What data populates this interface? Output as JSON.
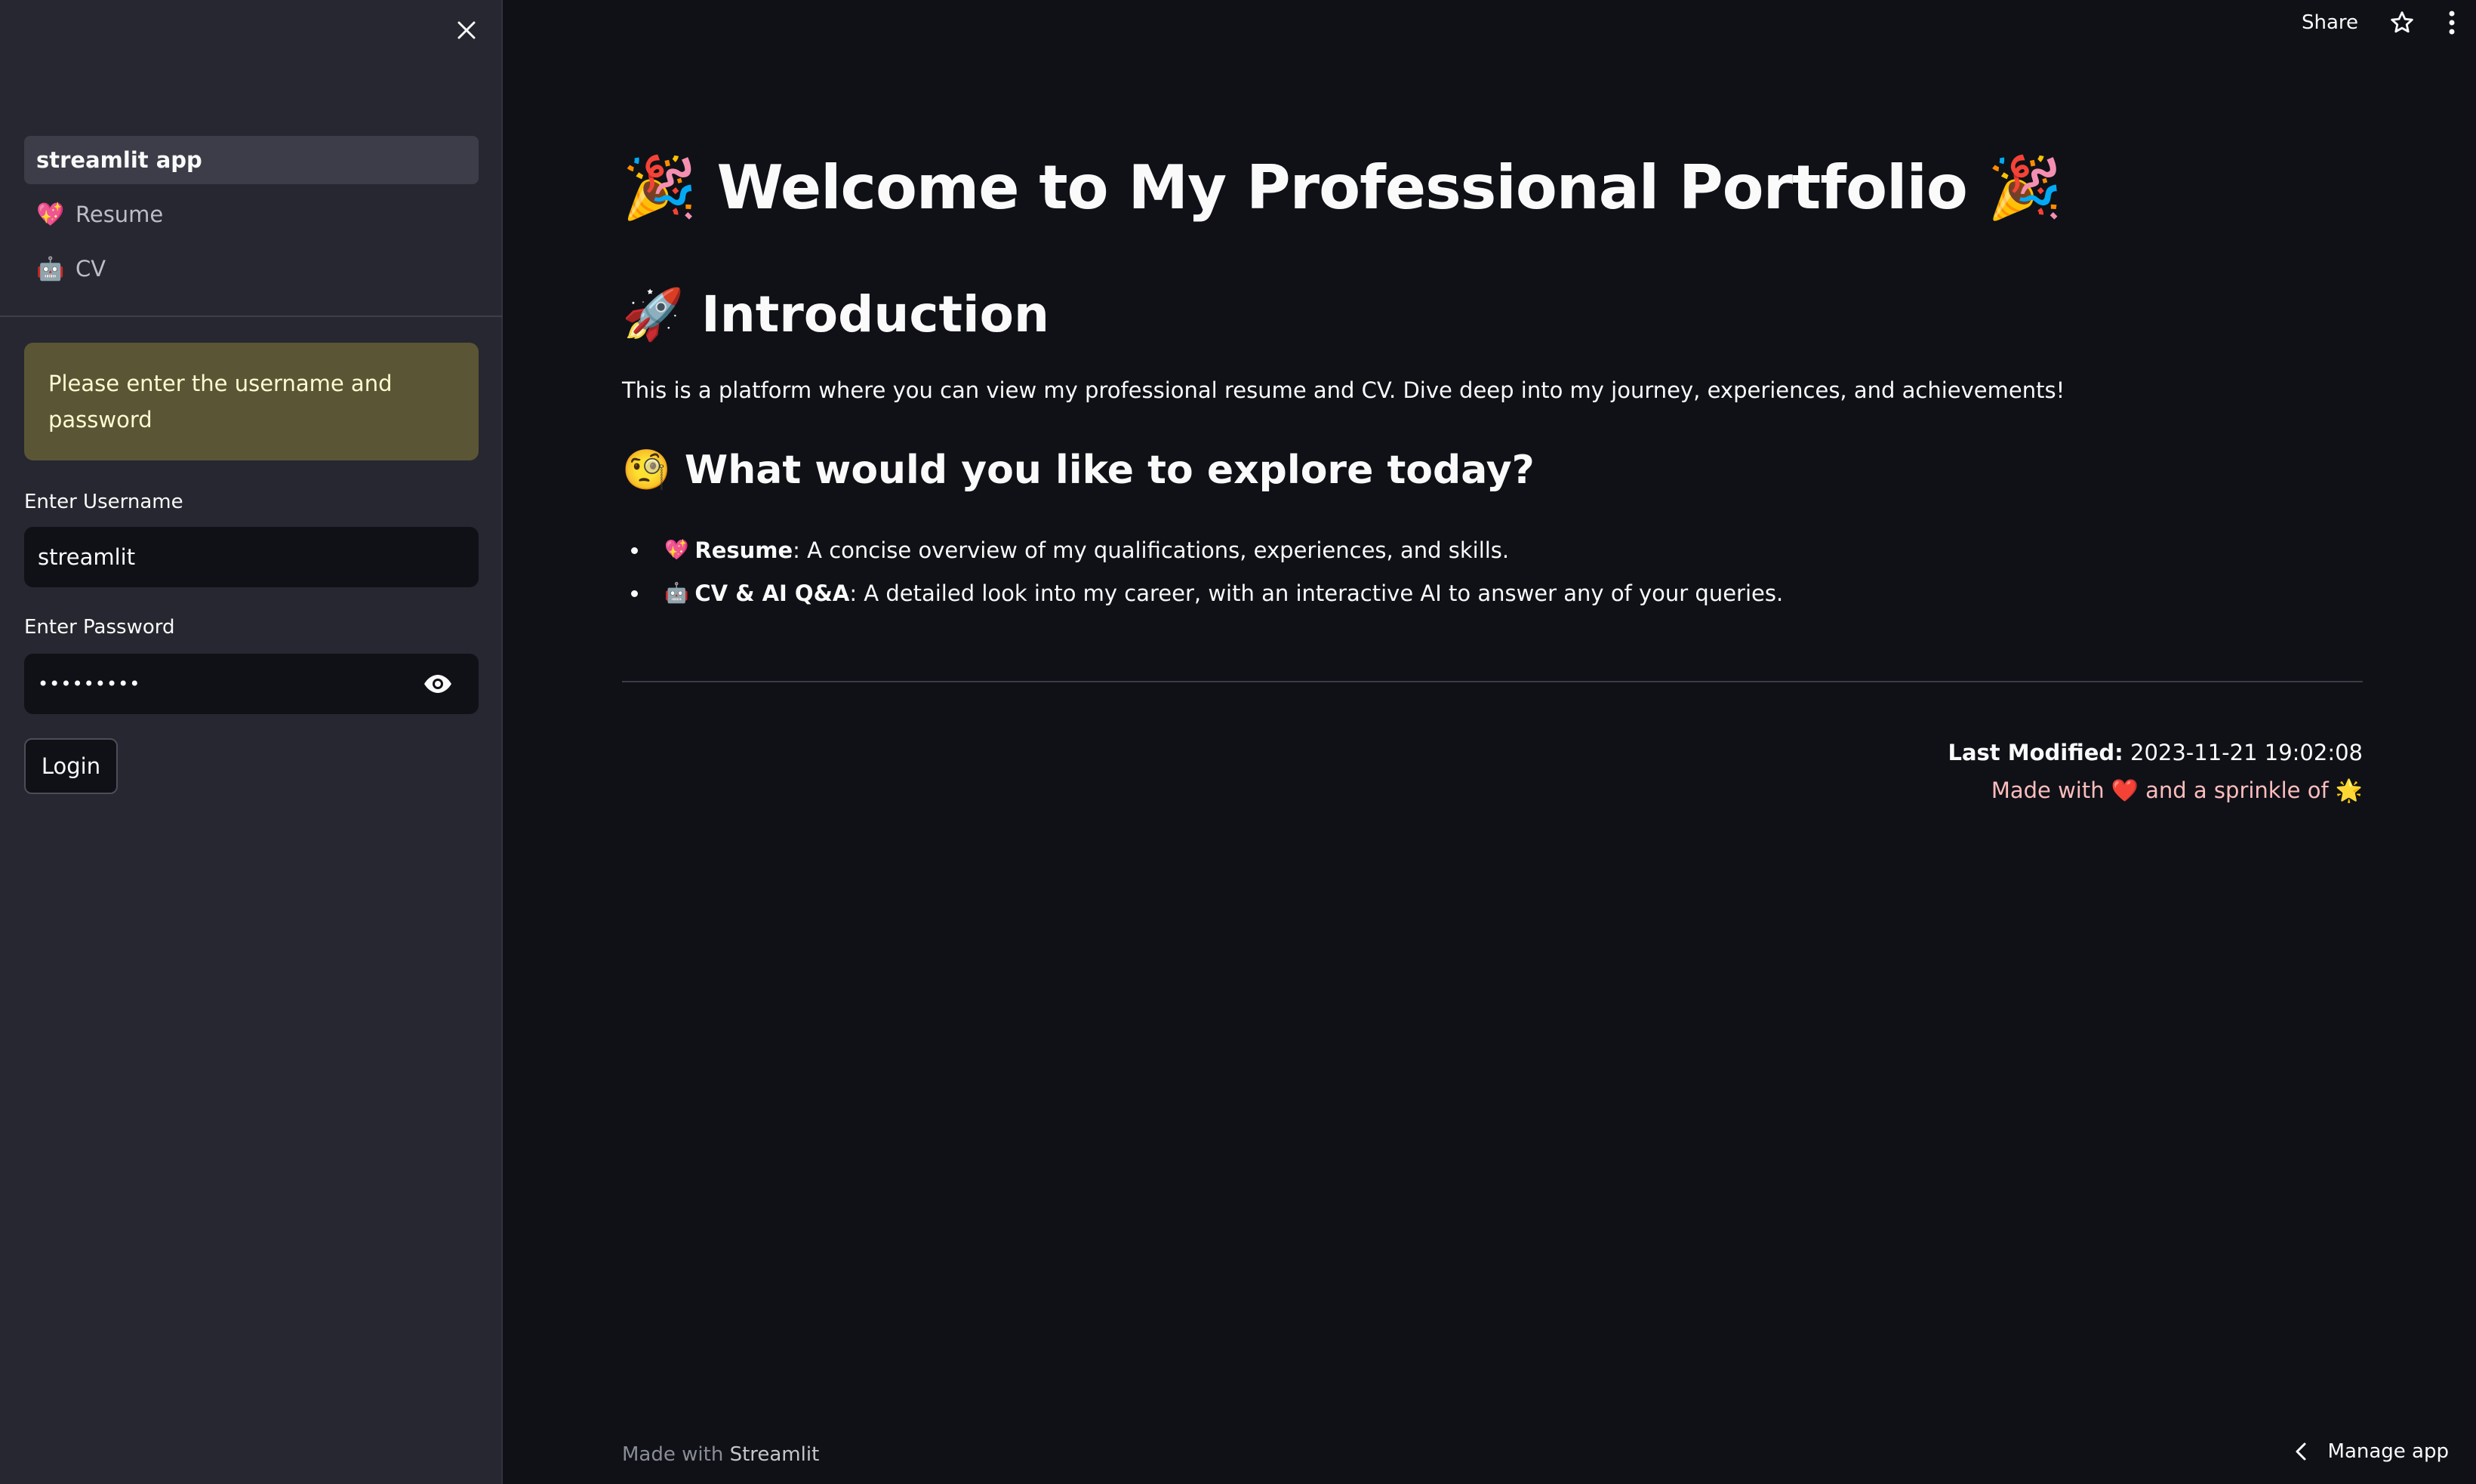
{
  "sidebar": {
    "close_label": "×",
    "nav": [
      {
        "icon": "",
        "label": "streamlit app"
      },
      {
        "icon": "💖",
        "label": "Resume"
      },
      {
        "icon": "🤖",
        "label": "CV"
      }
    ],
    "warning": "Please enter the username and password",
    "username": {
      "label": "Enter Username",
      "value": "streamlit"
    },
    "password": {
      "label": "Enter Password",
      "value": "•••••••••"
    },
    "login_label": "Login"
  },
  "topbar": {
    "share_label": "Share",
    "star_icon": "star-icon",
    "menu_icon": "kebab-menu-icon"
  },
  "main": {
    "title": "🎉 Welcome to My Professional Portfolio 🎉",
    "intro_heading": "🚀 Introduction",
    "intro_text": "This is a platform where you can view my professional resume and CV. Dive deep into my journey, experiences, and achievements!",
    "explore_heading": "🧐 What would you like to explore today?",
    "items": [
      {
        "icon": "💖",
        "bold": "Resume",
        "text": ": A concise overview of my qualifications, experiences, and skills."
      },
      {
        "icon": "🤖",
        "bold": "CV & AI Q&A",
        "text": ": A detailed look into my career, with an interactive AI to answer any of your queries."
      }
    ],
    "last_modified_label": "Last Modified:",
    "last_modified_value": " 2023-11-21 19:02:08",
    "made_with_text": "Made with ❤️ and a sprinkle of 🌟"
  },
  "footer": {
    "made_with": "Made with ",
    "brand": "Streamlit",
    "manage_app": "Manage app"
  }
}
